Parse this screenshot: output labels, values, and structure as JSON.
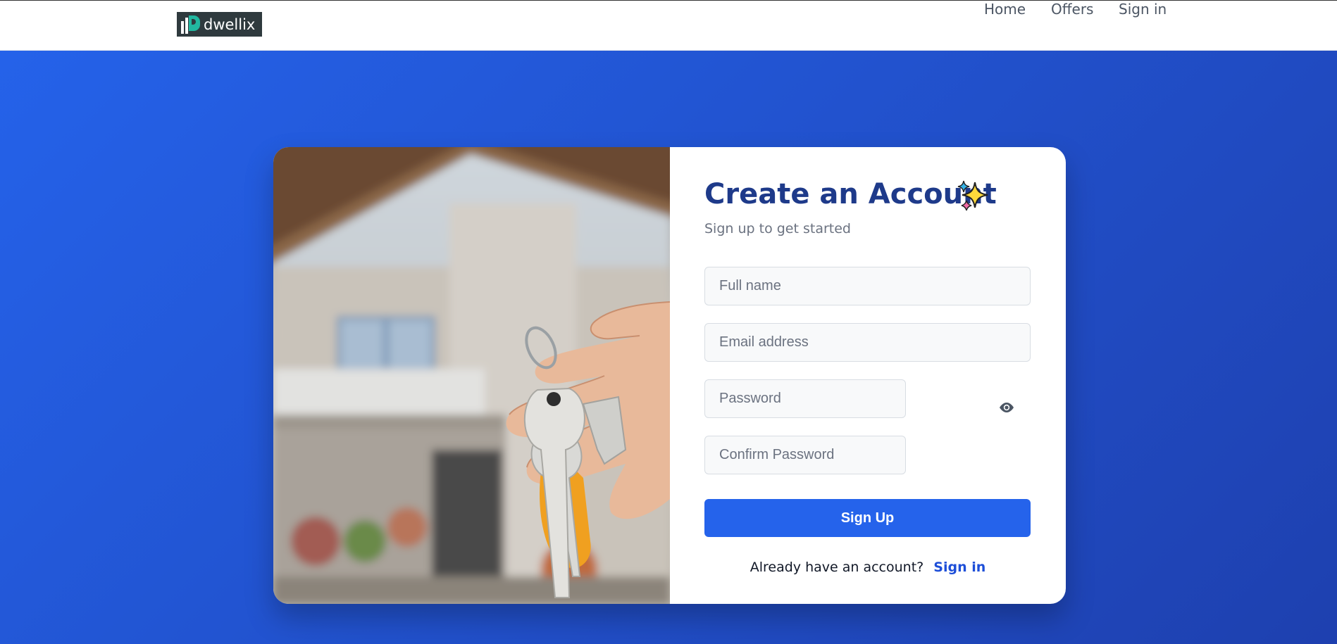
{
  "nav": {
    "brand": "dwellix",
    "links": [
      "Home",
      "Offers",
      "Sign in"
    ]
  },
  "form": {
    "title": "Create an Account",
    "subtitle": "Sign up to get started",
    "fullname_placeholder": "Full name",
    "email_placeholder": "Email address",
    "password_placeholder": "Password",
    "confirm_placeholder": "Confirm Password",
    "submit_label": "Sign Up",
    "footer_text": "Already have an account?",
    "footer_link": "Sign in"
  },
  "colors": {
    "background_start": "#2563eb",
    "background_end": "#1e40af",
    "title": "#1e3a8a",
    "button": "#2563eb",
    "link": "#1d4ed8"
  },
  "icons": {
    "logo": "building-logo-icon",
    "title_emoji": "sparkles-icon",
    "password_toggle": "eye-icon"
  },
  "image": {
    "subject": "hand holding house keys in front of a blurred house"
  }
}
